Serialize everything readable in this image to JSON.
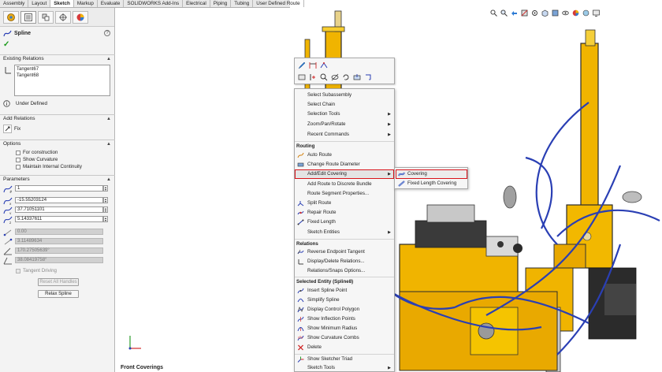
{
  "tabs": [
    "Assembly",
    "Layout",
    "Sketch",
    "Markup",
    "Evaluate",
    "SOLIDWORKS Add-Ins",
    "Electrical",
    "Piping",
    "Tubing",
    "User Defined Route"
  ],
  "active_tab": "Sketch",
  "panel": {
    "title": "Spline",
    "help": "?",
    "existing_relations": {
      "label": "Existing Relations",
      "items": [
        "Tangent67",
        "Tangent68"
      ],
      "status": "Under Defined"
    },
    "add_relations": {
      "label": "Add Relations",
      "fix_label": "Fix"
    },
    "options": {
      "label": "Options",
      "for_construction": "For construction",
      "show_curvature": "Show Curvature",
      "maintain_continuity": "Maintain Internal Continuity"
    },
    "parameters": {
      "label": "Parameters",
      "point_number": "1",
      "x": "-15.55203124",
      "y": "37.71051101",
      "z": "5.14337611",
      "weight1": "0.00",
      "weight2": "3.11489634",
      "angle1": "170.27505639°",
      "angle2": "38.08419758°",
      "tangent_driving": "Tangent Driving",
      "reset_all_handles": "Reset All Handles",
      "relax_spline": "Relax Spline"
    }
  },
  "graphics": {
    "view_name": "Front Coverings"
  },
  "context_menu": {
    "items_top": [
      "Select Subassembly",
      "Select Chain",
      "Selection Tools",
      "Zoom/Pan/Rotate",
      "Recent Commands"
    ],
    "routing_header": "Routing",
    "routing_items": [
      "Auto Route",
      "Change Route Diameter",
      "Add/Edit Covering",
      "Add Route to Discrete Bundle",
      "Route Segment Properties...",
      "Split Route",
      "Repair Route",
      "Fixed Length",
      "Sketch Entities"
    ],
    "relations_header": "Relations",
    "relations_items": [
      "Reverse Endpoint Tangent",
      "Display/Delete Relations...",
      "Relations/Snaps Options..."
    ],
    "selected_header": "Selected Entity (Spline8)",
    "selected_items": [
      "Insert Spline Point",
      "Simplify Spline",
      "Display Control Polygon",
      "Show Inflection Points",
      "Show Minimum Radius",
      "Show Curvature Combs",
      "Delete",
      "Show Sketcher Triad",
      "Sketch Tools"
    ]
  },
  "submenu": {
    "items": [
      "Covering",
      "Fixed Length Covering"
    ]
  },
  "colors": {
    "highlight_border": "#d9141b",
    "machine_yellow": "#f0b400",
    "tube_blue": "#2a3fb4"
  }
}
